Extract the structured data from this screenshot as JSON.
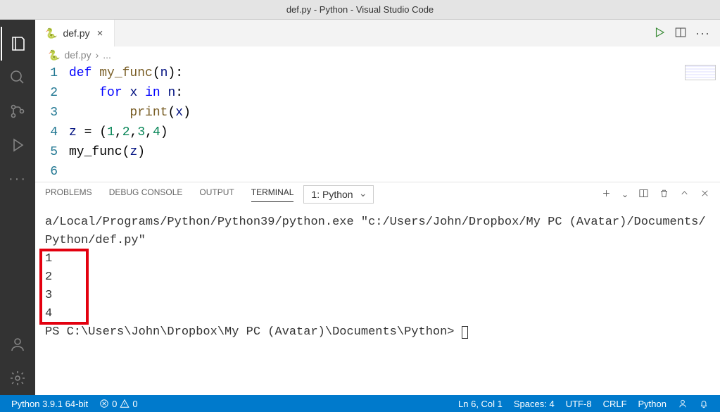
{
  "window": {
    "title": "def.py - Python - Visual Studio Code"
  },
  "tab": {
    "filename": "def.py"
  },
  "breadcrumb": {
    "file": "def.py",
    "sep": "›",
    "more": "..."
  },
  "code": {
    "lines": [
      "1",
      "2",
      "3",
      "4",
      "5",
      "6"
    ],
    "tokens": {
      "l1_def": "def",
      "l1_sp1": " ",
      "l1_fn": "my_func",
      "l1_open": "(",
      "l1_n": "n",
      "l1_close": "):",
      "l2_indent": "    ",
      "l2_for": "for",
      "l2_sp1": " ",
      "l2_x": "x",
      "l2_sp2": " ",
      "l2_in": "in",
      "l2_sp3": " ",
      "l2_n": "n",
      "l2_colon": ":",
      "l3_indent": "        ",
      "l3_print": "print",
      "l3_open": "(",
      "l3_x": "x",
      "l3_close": ")",
      "l4_z": "z",
      "l4_sp1": " ",
      "l4_eq": "=",
      "l4_sp2": " ",
      "l4_open": "(",
      "l4_1": "1",
      "l4_c1": ",",
      "l4_2": "2",
      "l4_c2": ",",
      "l4_3": "3",
      "l4_c3": ",",
      "l4_4": "4",
      "l4_close": ")",
      "l5_fn": "my_func",
      "l5_open": "(",
      "l5_z": "z",
      "l5_close": ")"
    }
  },
  "panel": {
    "tabs": {
      "problems": "PROBLEMS",
      "debug": "DEBUG CONSOLE",
      "output": "OUTPUT",
      "terminal": "TERMINAL"
    },
    "terminal_selector": "1: Python"
  },
  "terminal": {
    "cmd": "a/Local/Programs/Python/Python39/python.exe \"c:/Users/John/Dropbox/My PC (Avatar)/Documents/Python/def.py\"",
    "out1": "1",
    "out2": "2",
    "out3": "3",
    "out4": "4",
    "prompt": "PS C:\\Users\\John\\Dropbox\\My PC (Avatar)\\Documents\\Python> "
  },
  "status": {
    "python": "Python 3.9.1 64-bit",
    "errors": "0",
    "warnings": "0",
    "lncol": "Ln 6, Col 1",
    "spaces": "Spaces: 4",
    "encoding": "UTF-8",
    "eol": "CRLF",
    "lang": "Python"
  }
}
